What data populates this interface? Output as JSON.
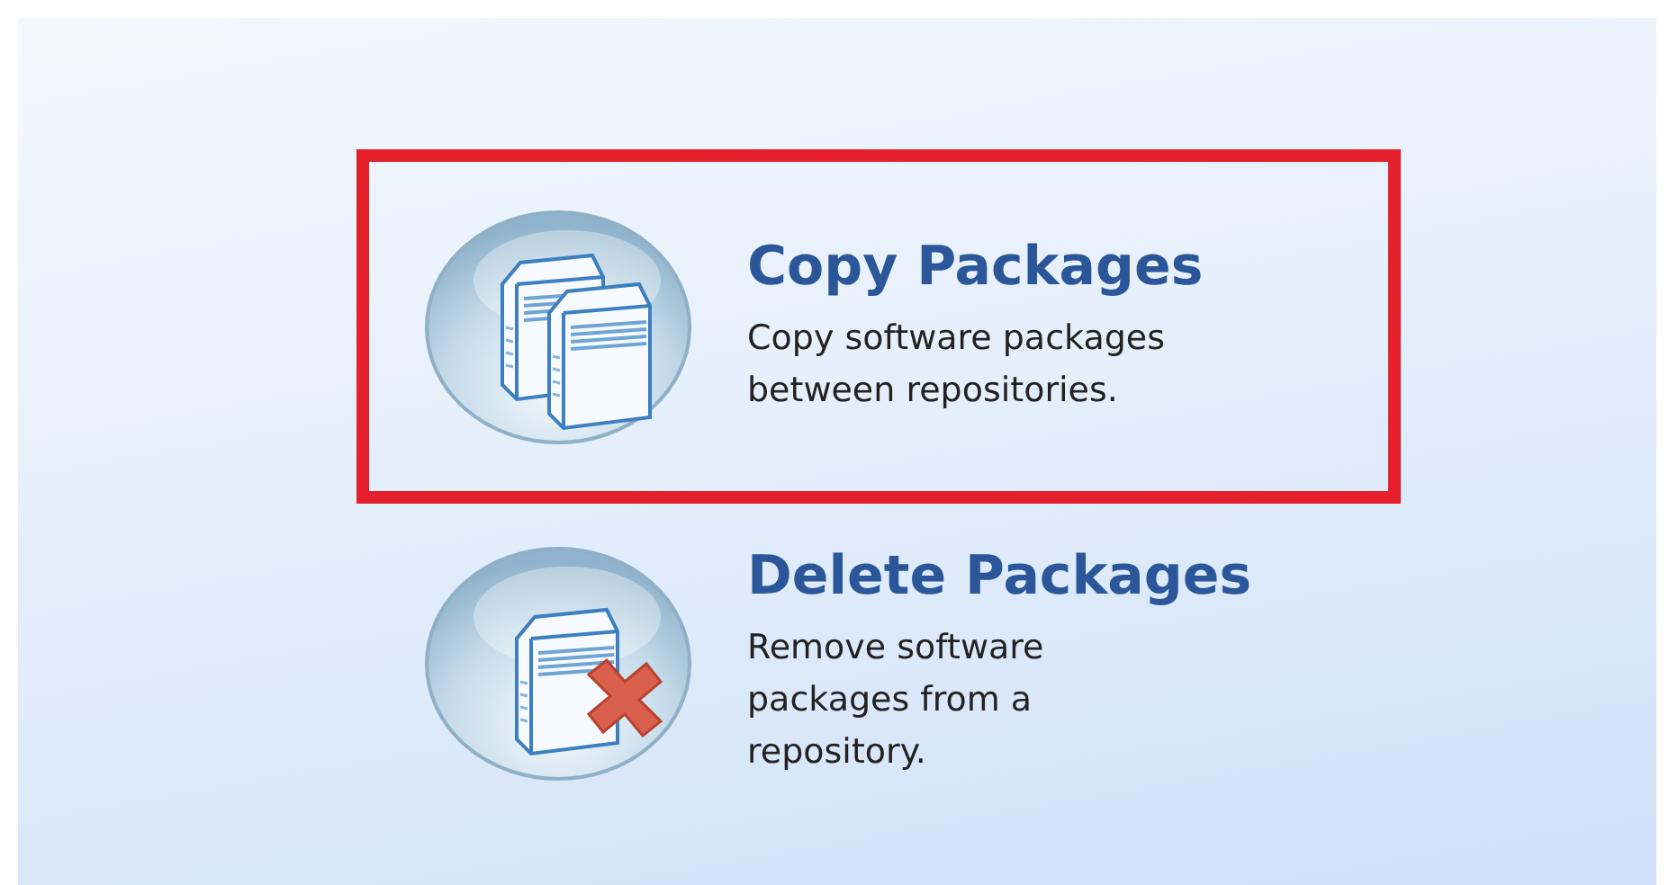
{
  "tasks": [
    {
      "kind": "copy",
      "title": "Copy Packages",
      "description": [
        "Copy software packages",
        "between repositories."
      ],
      "highlighted": true
    },
    {
      "kind": "delete",
      "title": "Delete Packages",
      "description": [
        "Remove software",
        "packages from a",
        "repository."
      ],
      "highlighted": false
    }
  ]
}
